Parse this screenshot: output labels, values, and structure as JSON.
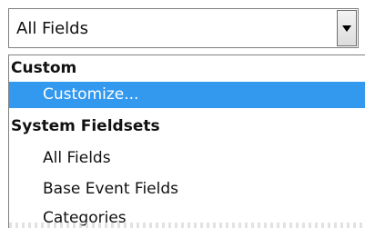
{
  "combo": {
    "value": "All Fields",
    "arrow_icon": "dropdown-arrow-icon"
  },
  "list": {
    "groups": [
      {
        "label": "Custom",
        "items": [
          {
            "label": "Customize...",
            "selected": true
          }
        ]
      },
      {
        "label": "System Fieldsets",
        "items": [
          {
            "label": "All Fields",
            "selected": false
          },
          {
            "label": "Base Event Fields",
            "selected": false
          },
          {
            "label": "Categories",
            "selected": false
          }
        ]
      }
    ]
  },
  "colors": {
    "selection": "#3399ee",
    "border": "#7f7f7f"
  }
}
